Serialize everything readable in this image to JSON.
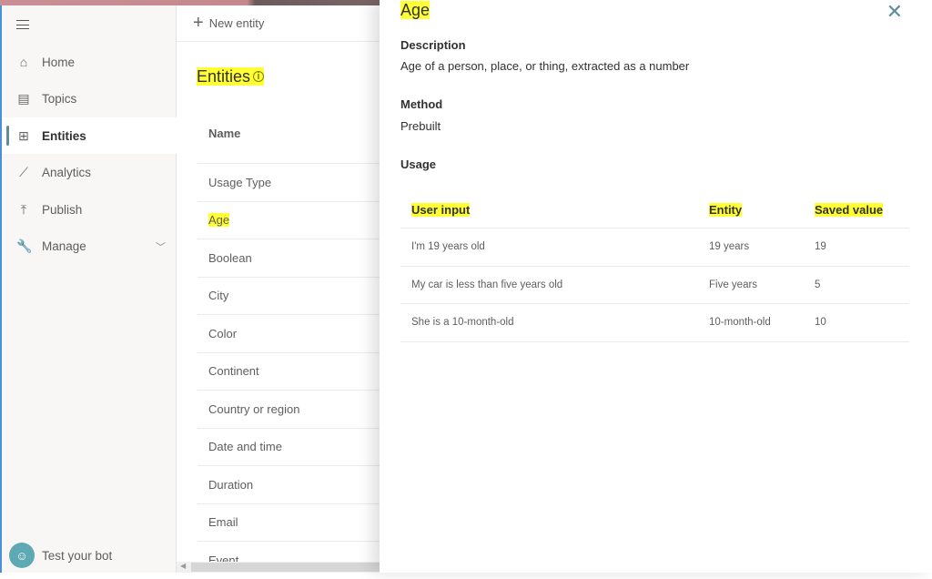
{
  "sidebar": {
    "items": [
      {
        "label": "Home",
        "icon": "home-icon",
        "glyph": "⌂"
      },
      {
        "label": "Topics",
        "icon": "chat-icon",
        "glyph": "▤"
      },
      {
        "label": "Entities",
        "icon": "entities-icon",
        "glyph": "⊞",
        "active": true
      },
      {
        "label": "Analytics",
        "icon": "chart-icon",
        "glyph": "⟋"
      },
      {
        "label": "Publish",
        "icon": "upload-icon",
        "glyph": "⤒"
      },
      {
        "label": "Manage",
        "icon": "wrench-icon",
        "glyph": "🔧"
      }
    ],
    "test_bot": "Test your bot"
  },
  "main": {
    "new_entity": "New entity",
    "title": "Entities",
    "column_name": "Name",
    "rows": [
      "Usage Type",
      "Age",
      "Boolean",
      "City",
      "Color",
      "Continent",
      "Country or region",
      "Date and time",
      "Duration",
      "Email",
      "Event"
    ],
    "highlighted_row": "Age"
  },
  "panel": {
    "title": "Age",
    "description_label": "Description",
    "description": "Age of a person, place, or thing, extracted as a number",
    "method_label": "Method",
    "method": "Prebuilt",
    "usage_label": "Usage",
    "columns": [
      "User input",
      "Entity",
      "Saved value"
    ],
    "rows": [
      [
        "I'm 19 years old",
        "19 years",
        "19"
      ],
      [
        "My car is less than five years old",
        "Five years",
        "5"
      ],
      [
        "She is a 10-month-old",
        "10-month-old",
        "10"
      ]
    ]
  },
  "colors": {
    "highlight": "#ffff33",
    "accent": "#5e8e9a"
  }
}
